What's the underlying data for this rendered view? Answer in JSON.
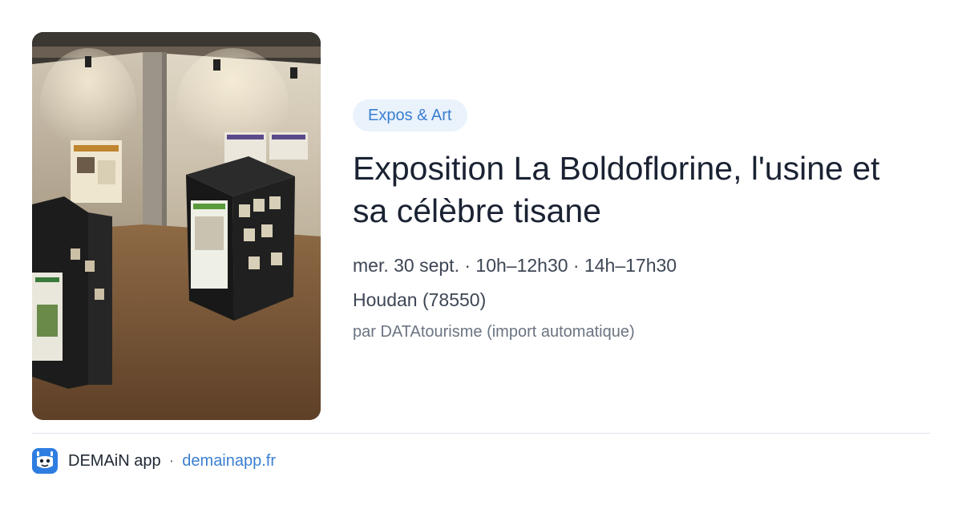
{
  "event": {
    "category": "Expos & Art",
    "title": "Exposition La Boldoflorine, l'usine et sa célèbre tisane",
    "date_line": "mer. 30 sept. · 10h–12h30 · 14h–17h30",
    "location": "Houdan (78550)",
    "source": "par DATAtourisme (import automatique)"
  },
  "footer": {
    "app_name": "DEMAiN app",
    "separator": "·",
    "site": "demainapp.fr"
  },
  "colors": {
    "accent": "#3a7fd0",
    "badge_bg": "#eaf2fc",
    "title": "#1a2233",
    "logo": "#2f7de1"
  },
  "icons": {
    "app_logo": "demain-app-logo-icon"
  }
}
